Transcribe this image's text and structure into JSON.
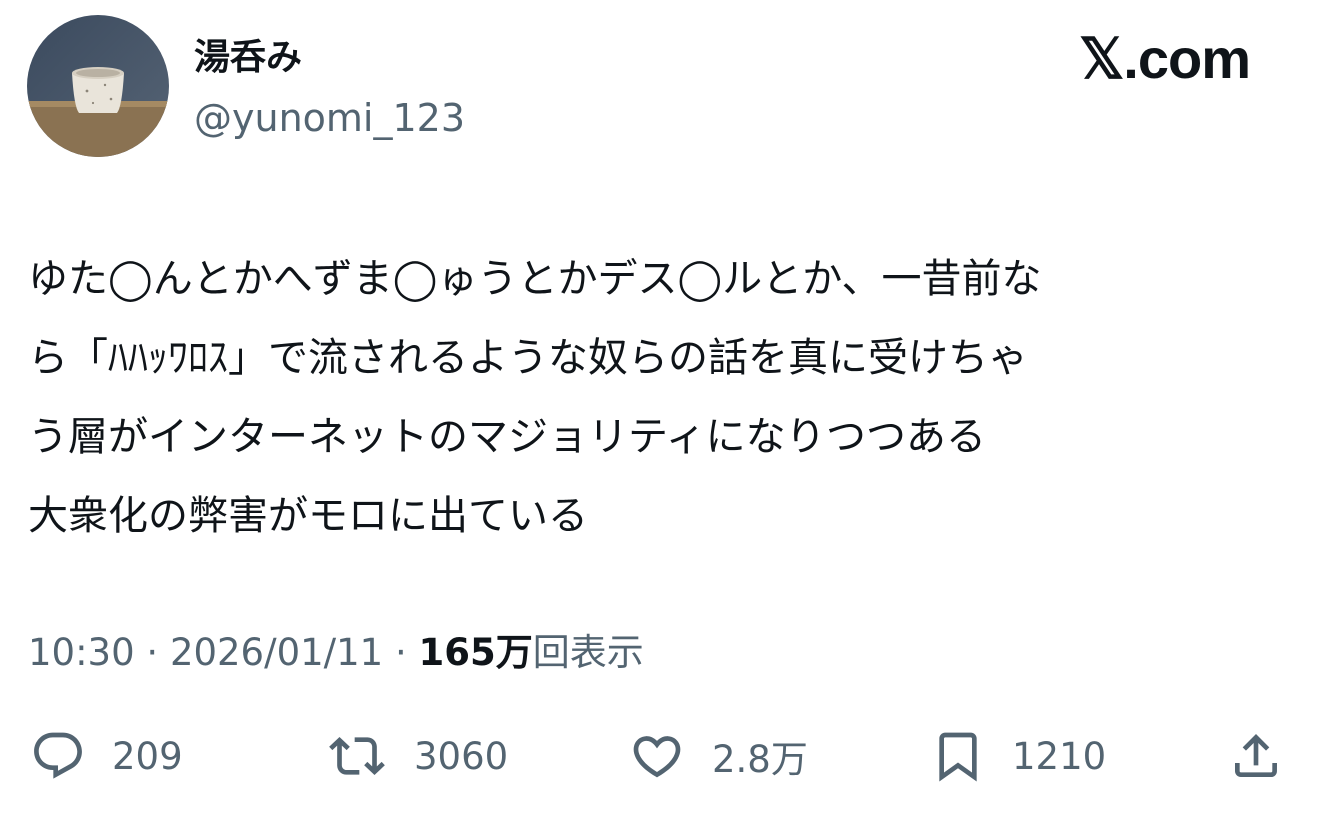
{
  "user": {
    "display_name": "湯呑み",
    "handle": "@yunomi_123",
    "avatar_icon": "teacup-avatar"
  },
  "site": {
    "logo_text": "𝕏.com"
  },
  "tweet": {
    "lines": [
      "ゆた◯んとかへずま◯ゅうとかデス◯ルとか、一昔前な",
      "ら「ﾊﾊｯﾜﾛｽ」で流されるような奴らの話を真に受けちゃ",
      "う層がインターネットのマジョリティになりつつある",
      "大衆化の弊害がモロに出ている"
    ]
  },
  "meta": {
    "time": "10:30",
    "separator": " · ",
    "date": "2026/01/11",
    "views_count": "165万",
    "views_label": "回表示"
  },
  "actions": {
    "reply": {
      "icon": "reply-icon",
      "count": "209"
    },
    "retweet": {
      "icon": "retweet-icon",
      "count": "3060"
    },
    "like": {
      "icon": "heart-icon",
      "count": "2.8万"
    },
    "bookmark": {
      "icon": "bookmark-icon",
      "count": "1210"
    },
    "share": {
      "icon": "share-icon"
    }
  },
  "colors": {
    "text_primary": "#0f1419",
    "text_secondary": "#536471",
    "background": "#ffffff"
  }
}
